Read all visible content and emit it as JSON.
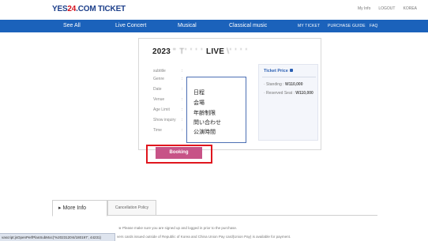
{
  "header": {
    "logo_prefix": "YES",
    "logo_number": "24",
    "logo_suffix": ".COM TICKET",
    "links": [
      "My Info",
      "LOGOUT",
      "KOREA"
    ]
  },
  "nav": {
    "items": [
      "See All",
      "Live Concert",
      "Musical",
      "Classical music"
    ],
    "right_items": [
      "MY TICKET",
      "PURCHASE GUIDE",
      "FAQ"
    ]
  },
  "event": {
    "title_year": "2023",
    "title_obscured": "\" T' ' ' ' ",
    "title_live": "LIVE",
    "title_tail": "\\' ' ' '"
  },
  "info": {
    "labels": [
      "subtitle",
      "Genre",
      "Date",
      "Venue",
      "Age Limit",
      "Show inquiry",
      "Time"
    ],
    "values": [
      ":",
      ":",
      ":",
      ":",
      ":",
      ":",
      ":"
    ]
  },
  "price": {
    "title": "Ticket Price",
    "items": [
      {
        "label": "· Standing : ",
        "value": "W110,000"
      },
      {
        "label": "· Reserved Seat : ",
        "value": "W110,000"
      }
    ]
  },
  "popup": {
    "items": [
      "日程",
      "会場",
      "年齢制限",
      "問い合わせ",
      "公演時間"
    ]
  },
  "booking": {
    "label": "Booking"
  },
  "tabs": {
    "more_info": "More Info",
    "cancellation": "Cancellation Policy"
  },
  "notice": {
    "line1": "※ Please make sure you are signed up and logged in prior to the purchase.",
    "line2": "vers cards issued outside of Republic of Korea and China Union Pay card(Union Pay) is available for payment."
  },
  "statusbar": {
    "url": "vascript:jsOpenPerfPlanSubMoc('%2023120!4/180197', 44231)"
  },
  "colors": {
    "nav_bg": "#1b62bb",
    "booking_bg": "#c75387",
    "highlight_border": "#e0161e",
    "popup_border": "#4c6fb4"
  }
}
